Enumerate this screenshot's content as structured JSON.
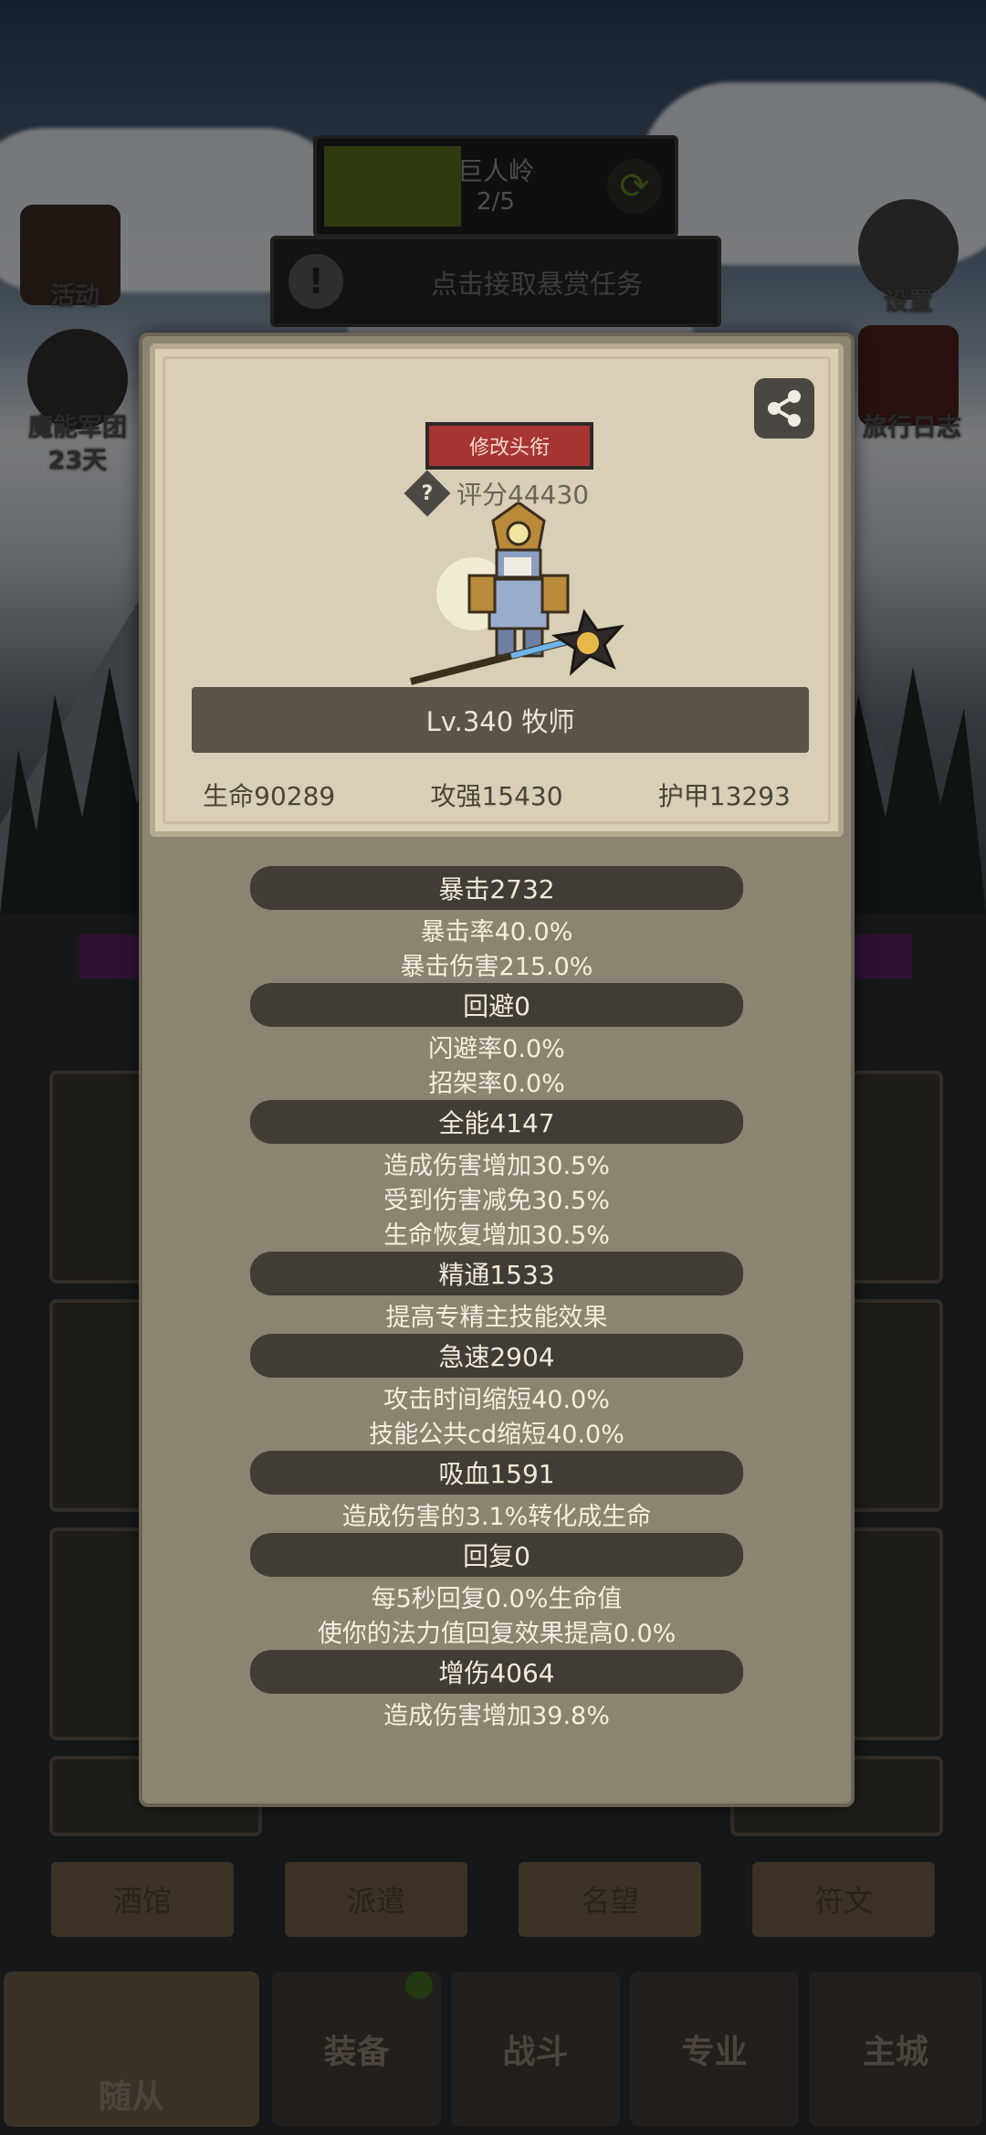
{
  "hud": {
    "region_name": "巨人岭",
    "region_progress": "2/5",
    "region_progress_fraction": 0.4,
    "bounty_text": "点击接取悬赏任务"
  },
  "side_buttons": {
    "activity": "活动",
    "settings": "设置",
    "legion": "魔能军团",
    "legion_days": "23天",
    "journal": "旅行日志"
  },
  "hero_card": {
    "change_title_button": "修改头衔",
    "score_label": "评分44430",
    "level_class": "Lv.340 牧师",
    "hp": "生命90289",
    "attack": "攻强15430",
    "armor": "护甲13293"
  },
  "stats": [
    {
      "header": "暴击2732",
      "lines": [
        "暴击率40.0%",
        "暴击伤害215.0%"
      ]
    },
    {
      "header": "回避0",
      "lines": [
        "闪避率0.0%",
        "招架率0.0%"
      ]
    },
    {
      "header": "全能4147",
      "lines": [
        "造成伤害增加30.5%",
        "受到伤害减免30.5%",
        "生命恢复增加30.5%"
      ]
    },
    {
      "header": "精通1533",
      "lines": [
        "提高专精主技能效果"
      ]
    },
    {
      "header": "急速2904",
      "lines": [
        "攻击时间缩短40.0%",
        "技能公共cd缩短40.0%"
      ]
    },
    {
      "header": "吸血1591",
      "lines": [
        "造成伤害的3.1%转化成生命"
      ]
    },
    {
      "header": "回复0",
      "lines": [
        "每5秒回复0.0%生命值",
        "使你的法力值回复效果提高0.0%"
      ]
    },
    {
      "header": "增伤4064",
      "lines": [
        "造成伤害增加39.8%"
      ]
    }
  ],
  "sub_tabs": [
    "酒馆",
    "派遣",
    "名望",
    "符文"
  ],
  "bottom_nav": [
    "随从",
    "装备",
    "战斗",
    "专业",
    "主城"
  ],
  "colors": {
    "panel": "#8c8473",
    "card": "#d8cfb6",
    "title_button": "#a73533",
    "section_pill": "#413c36",
    "region_fill": "#556b1e"
  }
}
